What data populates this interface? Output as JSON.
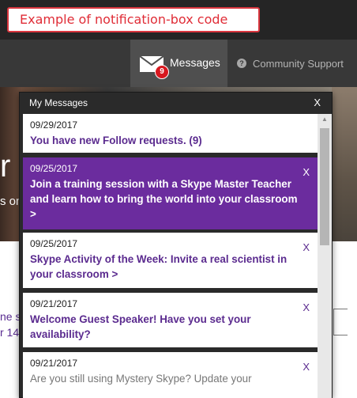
{
  "callout": "Example of notification-box code",
  "nav": {
    "messages_label": "Messages",
    "badge_count": "9",
    "community_label": "Community Support"
  },
  "hero": {
    "big_text": "r",
    "small_text": "s on"
  },
  "page_behind": {
    "line1": "ne s",
    "line2": "r 14"
  },
  "panel": {
    "title": "My Messages",
    "close": "X",
    "items": [
      {
        "date": "09/29/2017",
        "text": "You have new Follow requests. (9)",
        "dismiss": ""
      },
      {
        "date": "09/25/2017",
        "text": "Join a training session with a Skype Master Teacher and learn how to bring the world into your classroom >",
        "dismiss": "X"
      },
      {
        "date": "09/25/2017",
        "text": "Skype Activity of the Week: Invite a real scientist in your classroom >",
        "dismiss": "X"
      },
      {
        "date": "09/21/2017",
        "text": "Welcome Guest Speaker! Have you set your availability?",
        "dismiss": "X"
      },
      {
        "date": "09/21/2017",
        "text": "Are you still using Mystery Skype? Update your",
        "dismiss": "X"
      }
    ]
  },
  "colors": {
    "accent_purple": "#6b2c9e",
    "badge_red": "#d8181f",
    "callout_red": "#e02d37"
  }
}
